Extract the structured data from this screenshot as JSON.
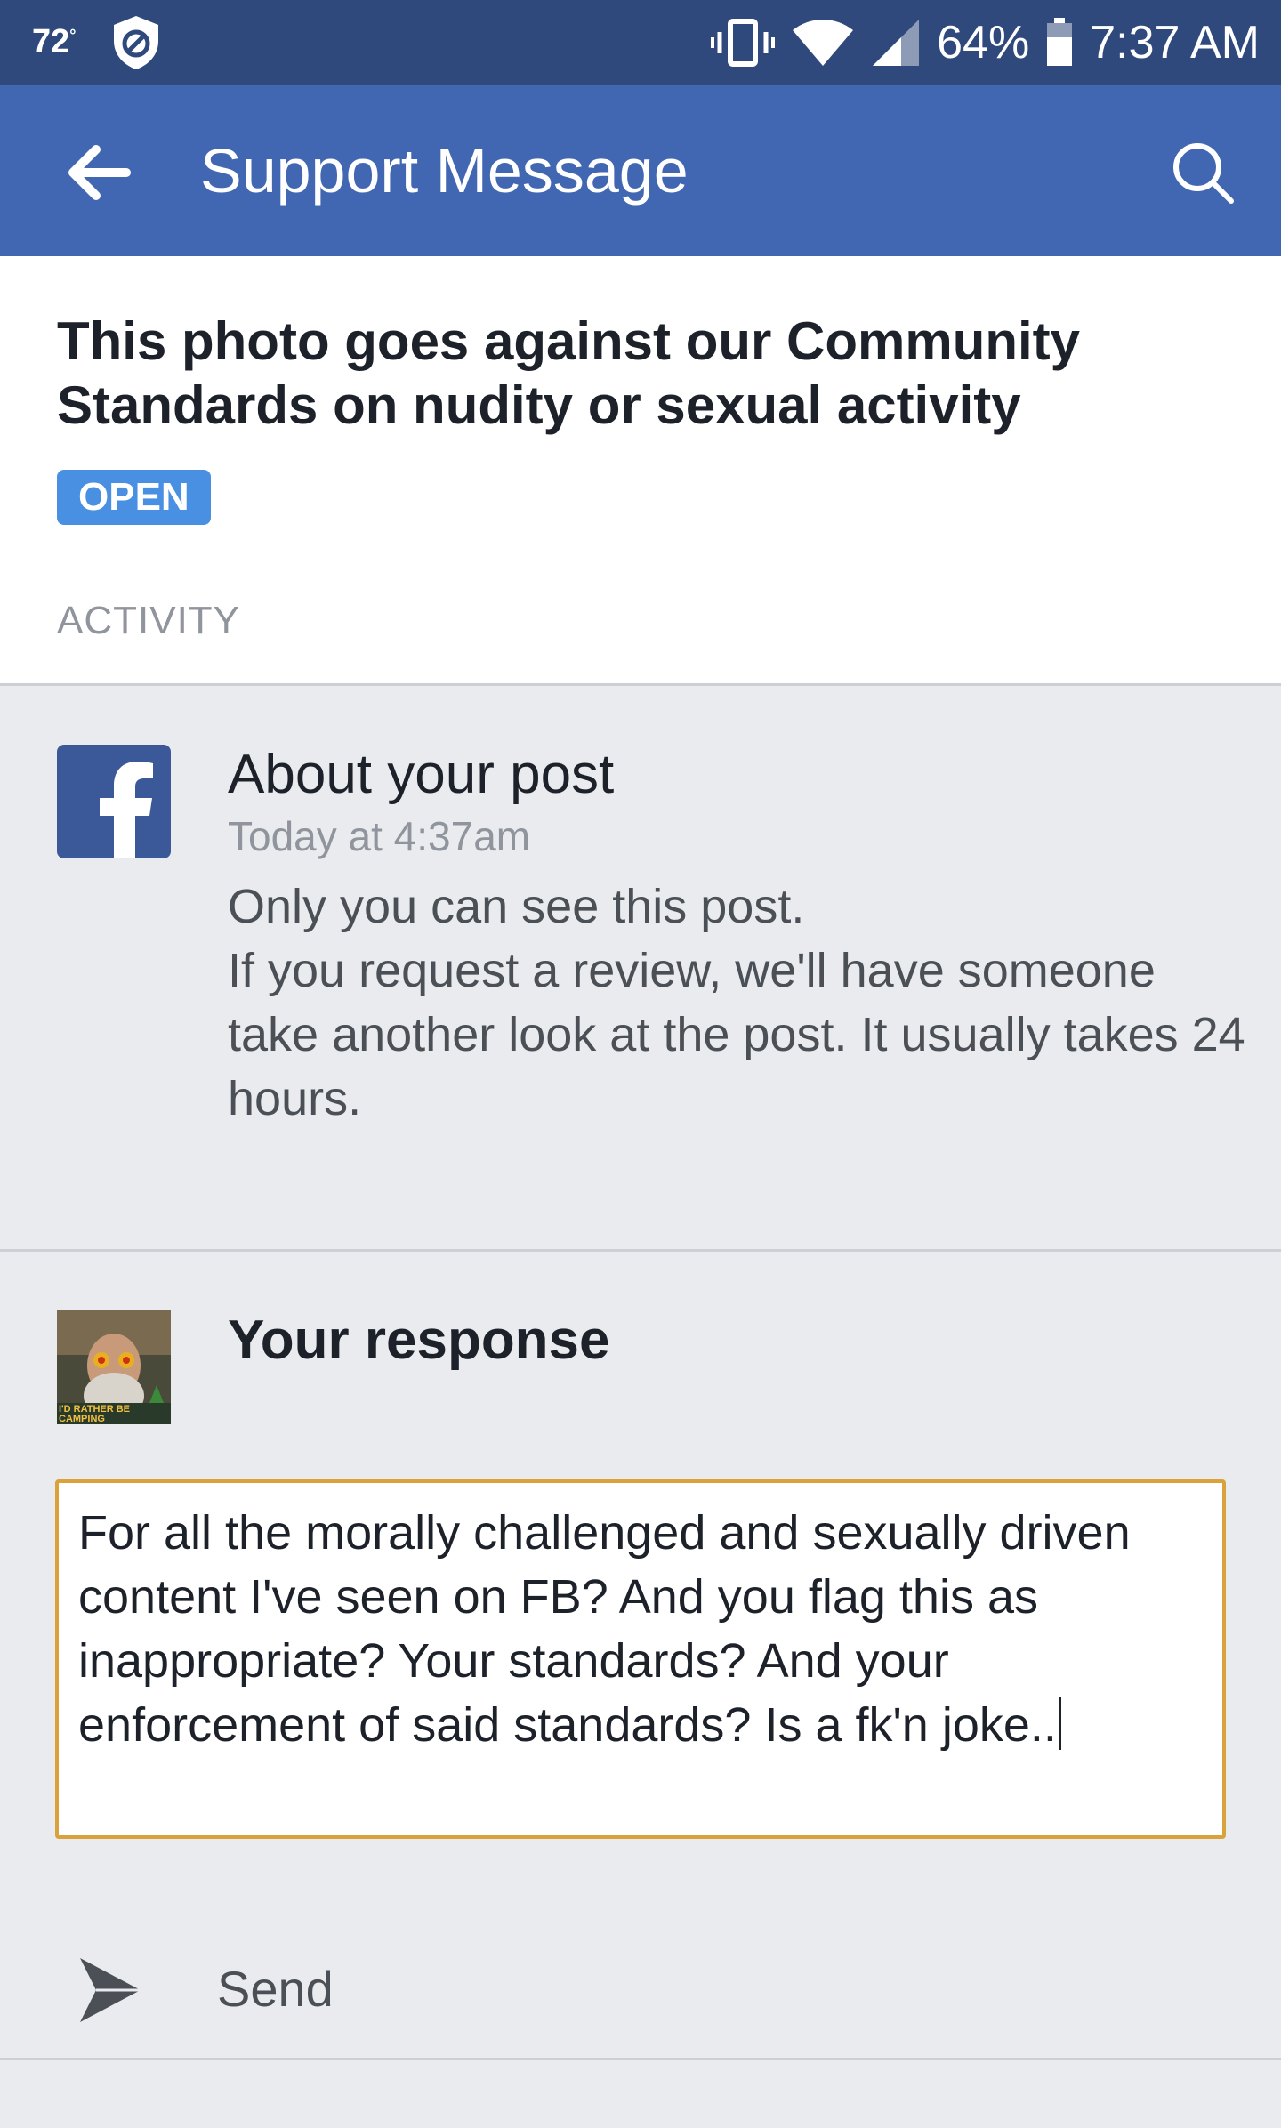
{
  "status_bar": {
    "temperature": "72",
    "temperature_unit": "°",
    "battery": "64%",
    "time": "7:37 AM",
    "icons": [
      "shield-icon",
      "vibrate-icon",
      "wifi-icon",
      "cell-signal-icon",
      "battery-icon"
    ]
  },
  "app_bar": {
    "title": "Support Message",
    "back_icon": "arrow-left-icon",
    "search_icon": "search-icon",
    "color": "#4267b2"
  },
  "header": {
    "headline": "This photo goes against our Community Standards on nudity or sexual activity",
    "status": "OPEN",
    "status_color": "#4a90e2",
    "section_label": "ACTIVITY"
  },
  "message": {
    "title": "About your post",
    "time": "Today at 4:37am",
    "line1": "Only you can see this post.",
    "line2": "If you request a review, we'll have someone take another look at the post. It usually takes 24 hours."
  },
  "response": {
    "title": "Your response",
    "avatar_caption": "I'D RATHER BE CAMPING",
    "text": "For all the morally challenged and sexually driven content I've seen on FB? And you flag this as inappropriate? Your standards? And your enforcement of said standards? Is a fk'n joke..",
    "send_label": "Send",
    "input_border_color": "#d9a23b"
  }
}
